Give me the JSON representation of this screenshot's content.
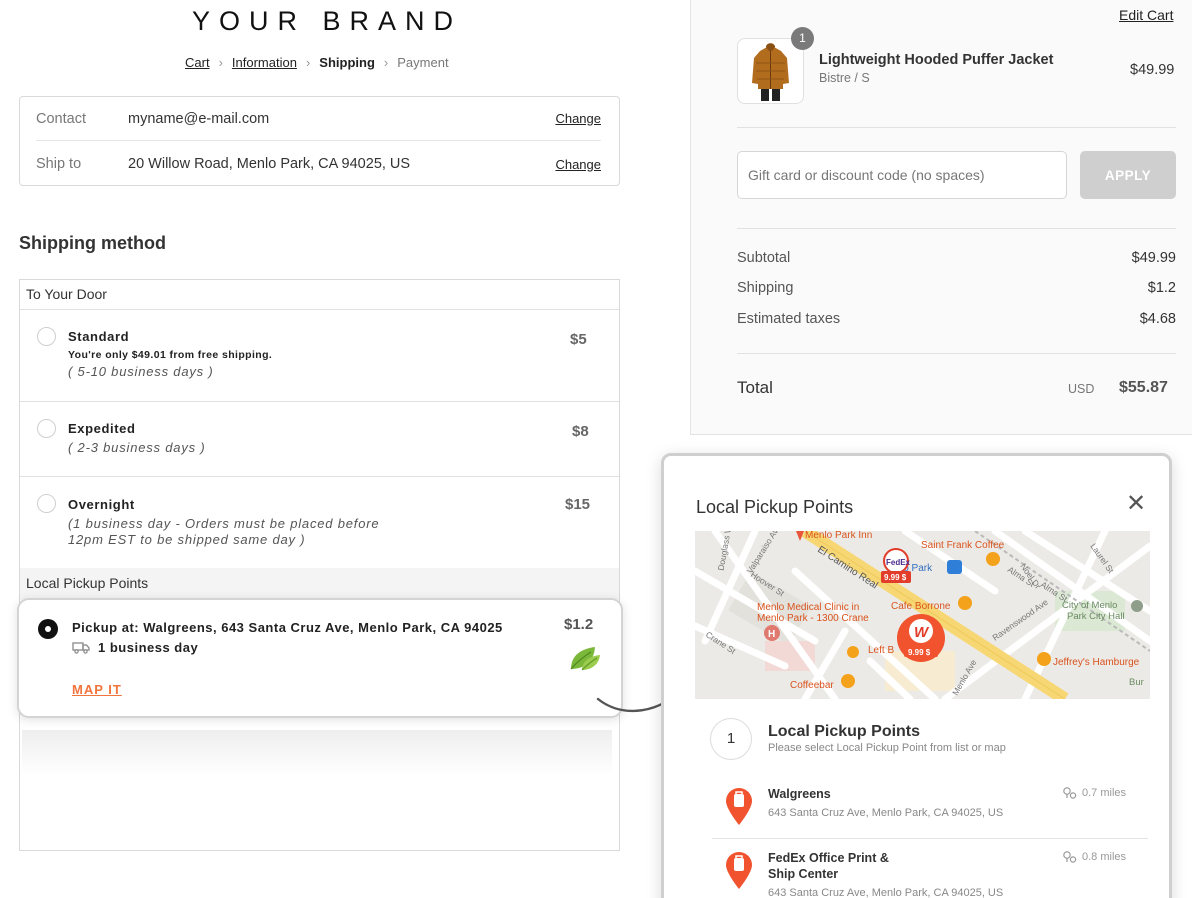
{
  "brand": "YOUR BRAND",
  "breadcrumb": [
    {
      "label": "Cart",
      "state": "link"
    },
    {
      "label": "Information",
      "state": "link"
    },
    {
      "label": "Shipping",
      "state": "current"
    },
    {
      "label": "Payment",
      "state": "upcoming"
    }
  ],
  "contact": {
    "contact_label": "Contact",
    "contact_value": "myname@e-mail.com",
    "ship_label": "Ship to",
    "ship_value": "20 Willow Road, Menlo Park, CA 94025, US",
    "change_label": "Change"
  },
  "shipping": {
    "heading": "Shipping method",
    "door_group": "To Your Door",
    "options": [
      {
        "title": "Standard",
        "note": "You're only $49.01 from free shipping.",
        "days": "( 5-10 business days )",
        "price": "$5"
      },
      {
        "title": "Expedited",
        "days": "( 2-3 business days )",
        "price": "$8"
      },
      {
        "title": "Overnight",
        "days_line1": "(1 business day - Orders must be placed before",
        "days_line2": "12pm EST to be shipped same day )",
        "price": "$15"
      }
    ],
    "pickup_group": "Local Pickup Points",
    "pickup": {
      "text": "Pickup at: Walgreens, 643 Santa Cruz Ave, Menlo Park, CA 94025",
      "days": "1 business day",
      "price": "$1.2",
      "map_link": "MAP IT",
      "selected": true
    }
  },
  "cart": {
    "edit_label": "Edit Cart",
    "item": {
      "name": "Lightweight Hooded Puffer Jacket",
      "variant": "Bistre / S",
      "price": "$49.99",
      "quantity": "1"
    },
    "discount_placeholder": "Gift card or discount code (no spaces)",
    "apply_label": "APPLY",
    "subtotal_label": "Subtotal",
    "subtotal_value": "$49.99",
    "shipping_label": "Shipping",
    "shipping_value": "$1.2",
    "taxes_label": "Estimated taxes",
    "taxes_value": "$4.68",
    "total_label": "Total",
    "currency": "USD",
    "total_value": "$55.87"
  },
  "modal": {
    "title": "Local Pickup Points",
    "close_icon": "close-icon",
    "step_number": "1",
    "step_title": "Local Pickup Points",
    "step_subtitle": "Please select Local Pickup Point from list or map",
    "map_labels": {
      "menlo_park_inn": "Menlo Park Inn",
      "saint_frank": "Saint Frank Coffee",
      "menlo_park_station": "lo Park",
      "el_camino": "El Camino Real",
      "menlo_medical_1": "Menlo Medical Clinic in",
      "menlo_medical_2": "Menlo Park - 1300 Crane",
      "cafe_borrone": "Cafe Borrone",
      "city_hall_1": "City of Menlo",
      "city_hall_2": "Park City Hall",
      "left_bank": "Left B",
      "jeffreys": "Jeffrey's Hamburge",
      "coffeebar": "Coffeebar",
      "bur": "Bur",
      "valparaiso": "Valparaiso Ave",
      "hoover": "Hoover St",
      "crane": "Crane St",
      "alma": "Alma St",
      "ravenswood": "Ravenswood Ave",
      "noel": "Noel Dr",
      "laurel": "Laurel St",
      "douglass": "Douglass Way",
      "menlo_ave": "Menlo Ave",
      "fedex_price": "9.99 $",
      "walgreens_price": "9.99 $",
      "fedex_logo": "FedEx",
      "walgreens_logo": "W"
    },
    "locations": [
      {
        "name": "Walgreens",
        "address": "643 Santa Cruz Ave, Menlo Park, CA 94025, US",
        "distance": "0.7 miles"
      },
      {
        "name_line1": "FedEx Office Print &",
        "name_line2": "Ship Center",
        "address": "643 Santa Cruz Ave, Menlo Park, CA 94025, US",
        "distance": "0.8 miles"
      }
    ]
  },
  "colors": {
    "accent": "#f0743c",
    "pin": "#f0532e",
    "map_road": "#f7d774"
  }
}
